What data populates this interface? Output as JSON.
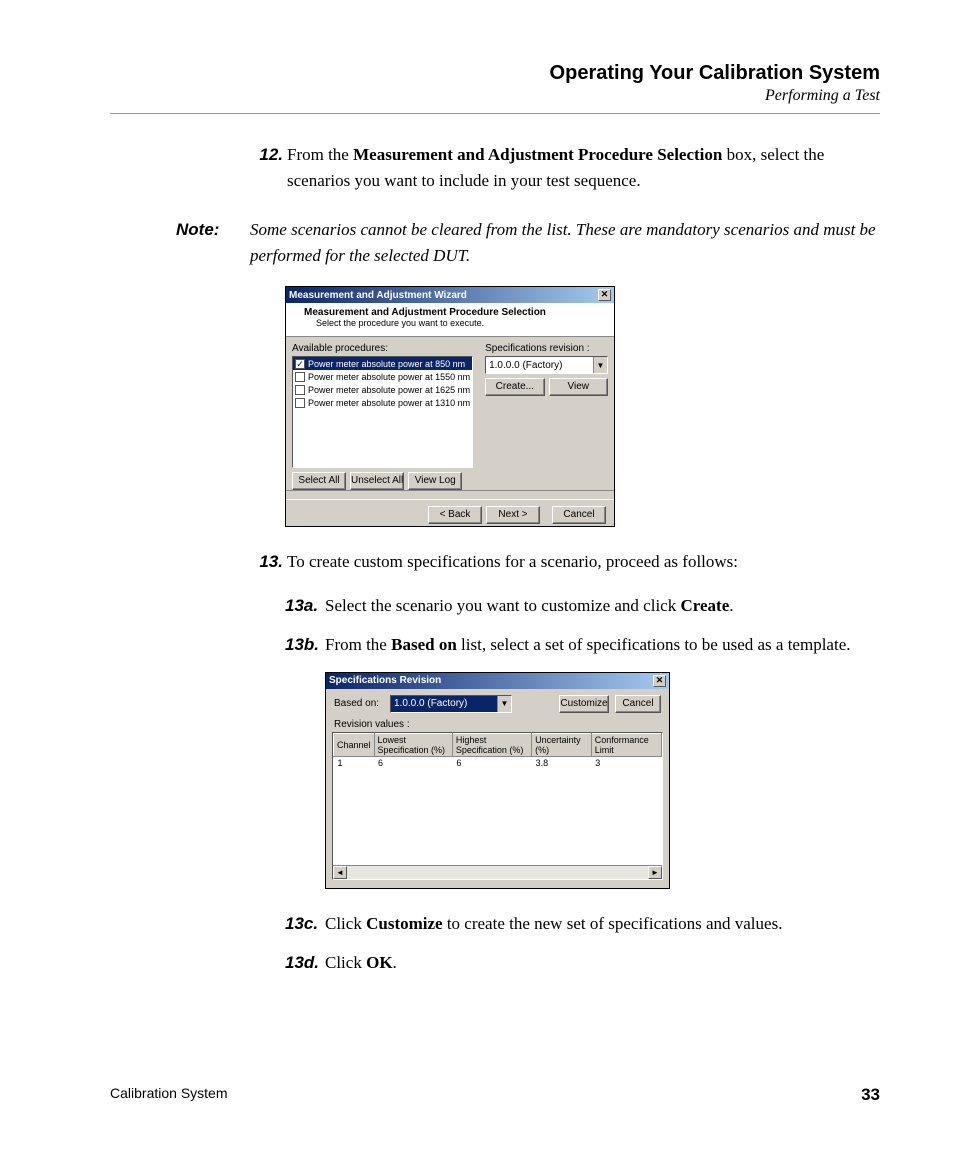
{
  "header": {
    "chapter": "Operating Your Calibration System",
    "section": "Performing a Test"
  },
  "steps": {
    "s12": {
      "num": "12.",
      "t1": "From the ",
      "b1": "Measurement and Adjustment Procedure Selection",
      "t2": " box, select the scenarios you want to include in your test sequence."
    },
    "note": {
      "label": "Note:",
      "text": "Some scenarios cannot be cleared from the list. These are mandatory scenarios and must be performed for the selected DUT."
    },
    "s13": {
      "num": "13.",
      "text": "To create custom specifications for a scenario, proceed as follows:"
    },
    "s13a": {
      "num": "13a.",
      "t1": "Select the scenario you want to customize and click ",
      "b1": "Create",
      "t2": "."
    },
    "s13b": {
      "num": "13b.",
      "t1": "From the ",
      "b1": "Based on",
      "t2": " list, select a set of specifications to be used as a template."
    },
    "s13c": {
      "num": "13c.",
      "t1": "Click ",
      "b1": "Customize",
      "t2": " to create the new set of specifications and values."
    },
    "s13d": {
      "num": "13d.",
      "t1": "Click ",
      "b1": "OK",
      "t2": "."
    }
  },
  "dlg1": {
    "title": "Measurement and Adjustment Wizard",
    "banner_title": "Measurement and Adjustment Procedure Selection",
    "banner_sub": "Select the procedure you want to execute.",
    "avail_label": "Available procedures:",
    "spec_label": "Specifications revision :",
    "procs": [
      {
        "label": "Power meter absolute power at 850 nm",
        "checked": true,
        "selected": true
      },
      {
        "label": "Power meter absolute power at 1550 nm",
        "checked": false,
        "selected": false
      },
      {
        "label": "Power meter absolute power at 1625 nm",
        "checked": false,
        "selected": false
      },
      {
        "label": "Power meter absolute power at 1310 nm",
        "checked": false,
        "selected": false
      }
    ],
    "combo_value": "1.0.0.0 (Factory)",
    "btn_create": "Create...",
    "btn_view": "View",
    "btn_select_all": "Select All",
    "btn_unselect_all": "Unselect All",
    "btn_view_log": "View Log",
    "btn_back": "< Back",
    "btn_next": "Next >",
    "btn_cancel": "Cancel"
  },
  "dlg2": {
    "title": "Specifications Revision",
    "based_on_label": "Based on:",
    "based_on_value": "1.0.0.0 (Factory)",
    "btn_customize": "Customize",
    "btn_cancel": "Cancel",
    "rev_label": "Revision values :",
    "columns": [
      "Channel",
      "Lowest Specification (%)",
      "Highest Specification (%)",
      "Uncertainty (%)",
      "Conformance Limit"
    ],
    "row": {
      "channel": "1",
      "low": "6",
      "high": "6",
      "unc": "3.8",
      "conf": "3"
    }
  },
  "footer": {
    "doc": "Calibration System",
    "page": "33"
  },
  "glyphs": {
    "close": "✕",
    "down": "▼",
    "left": "◄",
    "right": "►",
    "check": "✓"
  }
}
